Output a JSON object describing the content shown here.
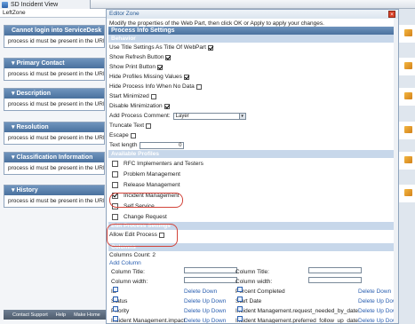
{
  "window": {
    "tab_title": "SD Incident View"
  },
  "left_zone": {
    "label": "LeftZone",
    "parts": [
      {
        "title": "Cannot login into ServiceDesk",
        "body": "process id must be present in the URL",
        "expandable": false
      },
      {
        "title": "Primary Contact",
        "body": "process id must be present in the URL",
        "expandable": true
      },
      {
        "title": "Description",
        "body": "process id must be present in the URL",
        "expandable": true
      },
      {
        "title": "Resolution",
        "body": "process id must be present in the URL",
        "expandable": true
      },
      {
        "title": "Classification Information",
        "body": "process id must be present in the URL",
        "expandable": true
      },
      {
        "title": "History",
        "body": "process id must be present in the URL",
        "expandable": true
      }
    ],
    "footer_links": [
      "Contact Support",
      "Help",
      "Make Home"
    ]
  },
  "editor": {
    "title": "Editor Zone",
    "intro": "Modify the properties of the Web Part, then click OK or Apply to apply your changes.",
    "section_title": "Process Info Settings",
    "behavior_header": "Behavior",
    "options": [
      {
        "label": "Use Title Settings As Title Of WebPart",
        "checked": true
      },
      {
        "label": "Show Refresh Button",
        "checked": true
      },
      {
        "label": "Show Print Button",
        "checked": true
      },
      {
        "label": "Hide Profiles Missing Values",
        "checked": true
      },
      {
        "label": "Hide Process Info When No Data",
        "checked": false
      },
      {
        "label": "Start Minimized",
        "checked": false
      },
      {
        "label": "Disable Minimization",
        "checked": true
      }
    ],
    "add_process_comment_label": "Add Process Comment:",
    "add_process_comment_value": "Layer",
    "truncate_label": "Truncate Text",
    "escape_label": "Escape",
    "text_length_label": "Text length",
    "text_length_value": "0",
    "profiles_header": "Available Profiles",
    "profiles": [
      {
        "label": "RFC Implementers and Testers",
        "checked": false
      },
      {
        "label": "Problem Management",
        "checked": false
      },
      {
        "label": "Release Management",
        "checked": false
      },
      {
        "label": "Incident Management",
        "checked": true
      },
      {
        "label": "Self Service",
        "checked": false
      },
      {
        "label": "Change Request",
        "checked": false
      }
    ],
    "edit_process_header": "Edit Process Settings",
    "allow_edit_label": "Allow Edit Process",
    "columns_header": "Columns",
    "columns_count_label": "Columns Count: 2",
    "add_column_link": "Add Column",
    "column_title_label": "Column Title:",
    "column_width_label": "Column width:",
    "column_rows": [
      {
        "left": "ID",
        "left_actions": "Delete Down",
        "right": "Percent Completed",
        "right_actions": "Delete Down"
      },
      {
        "left": "Status",
        "left_actions": "Delete Up Down",
        "right": "Start Date",
        "right_actions": "Delete Up Down"
      },
      {
        "left": "Priority",
        "left_actions": "Delete Up Down",
        "right": "Incident Management.request_needed_by_date",
        "right_actions": "Delete Up Down"
      },
      {
        "left": "Incident Management.impact",
        "left_actions": "Delete Up Down",
        "right": "Incident Management.preferred_follow_up_date",
        "right_actions": "Delete Up Down"
      }
    ]
  },
  "colors": {
    "accent": "#4a719e",
    "highlight": "#d2443a"
  }
}
